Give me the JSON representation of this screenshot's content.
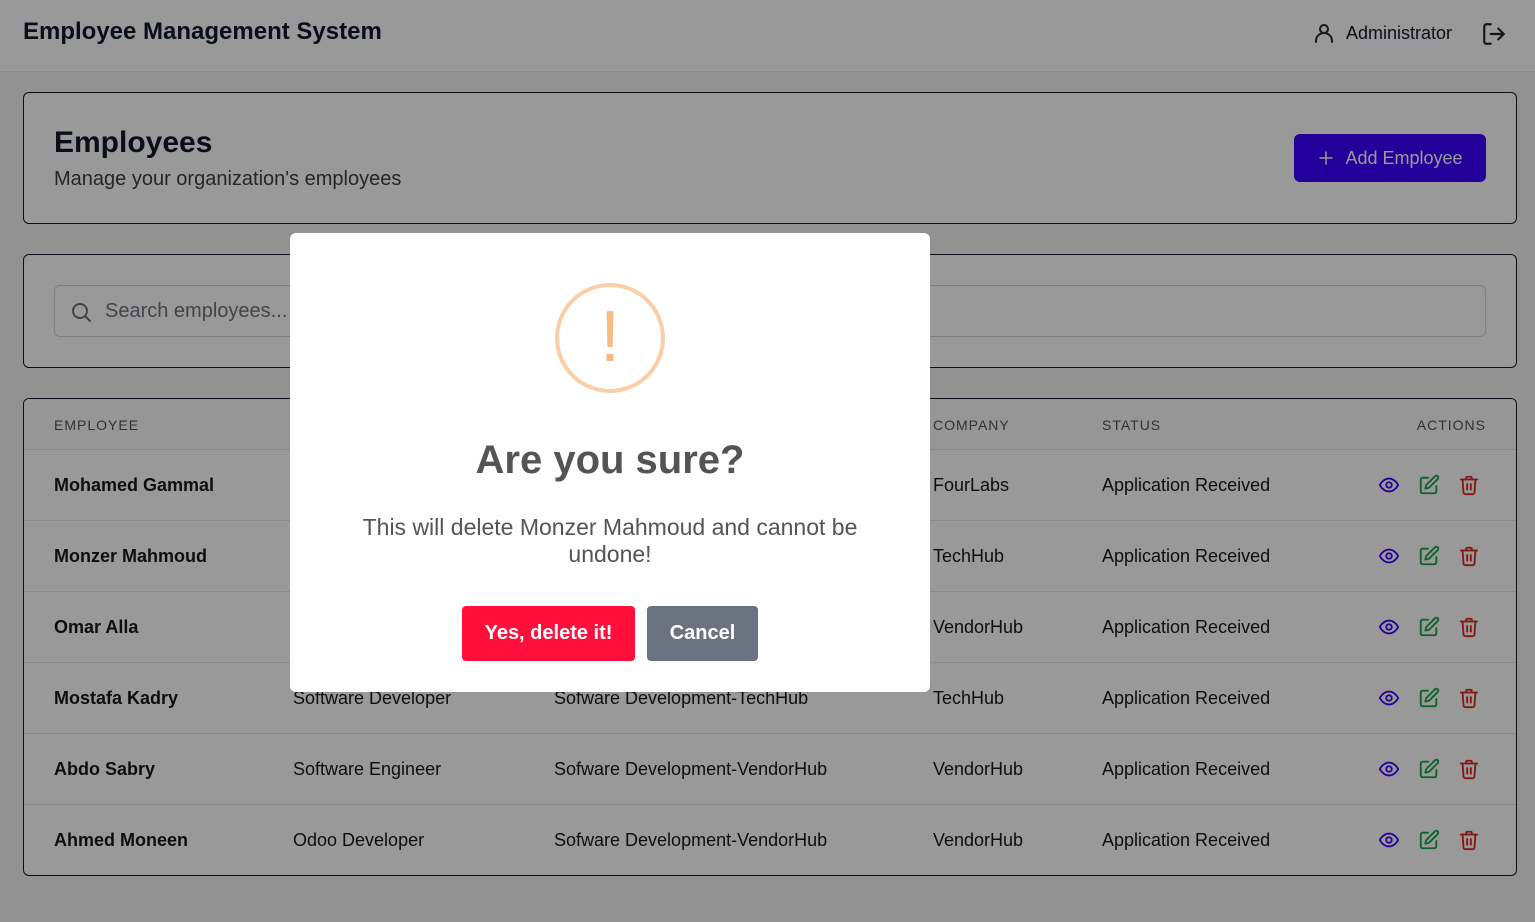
{
  "header": {
    "app_title": "Employee Management System",
    "user_name": "Administrator"
  },
  "page": {
    "title": "Employees",
    "subtitle": "Manage your organization's employees",
    "add_button_label": "Add Employee"
  },
  "search": {
    "placeholder": "Search employees..."
  },
  "table": {
    "headers": {
      "employee": "EMPLOYEE",
      "company": "COMPANY",
      "status": "STATUS",
      "actions": "ACTIONS"
    },
    "rows": [
      {
        "name": "Mohamed Gammal",
        "position": "",
        "department": "",
        "company": "FourLabs",
        "status": "Application Received"
      },
      {
        "name": "Monzer Mahmoud",
        "position": "",
        "department": "",
        "company": "TechHub",
        "status": "Application Received"
      },
      {
        "name": "Omar Alla",
        "position": "",
        "department": "",
        "company": "VendorHub",
        "status": "Application Received"
      },
      {
        "name": "Mostafa Kadry",
        "position": "Software Developer",
        "department": "Sofware Development-TechHub",
        "company": "TechHub",
        "status": "Application Received"
      },
      {
        "name": "Abdo Sabry",
        "position": "Software Engineer",
        "department": "Sofware Development-VendorHub",
        "company": "VendorHub",
        "status": "Application Received"
      },
      {
        "name": "Ahmed Moneen",
        "position": "Odoo Developer",
        "department": "Sofware Development-VendorHub",
        "company": "VendorHub",
        "status": "Application Received"
      }
    ],
    "action_icons": [
      "eye-icon",
      "edit-icon",
      "trash-icon"
    ]
  },
  "modal": {
    "icon_glyph": "!",
    "title": "Are you sure?",
    "text": "This will delete Monzer Mahmoud and cannot be undone!",
    "confirm_label": "Yes, delete it!",
    "cancel_label": "Cancel"
  },
  "colors": {
    "primary": "#3b00ff",
    "danger": "#ff0f3a",
    "cancel": "#6b7280",
    "warning": "#f8bb86",
    "view_icon": "#3b00ff",
    "edit_icon": "#16a34a",
    "delete_icon": "#dc2626"
  }
}
